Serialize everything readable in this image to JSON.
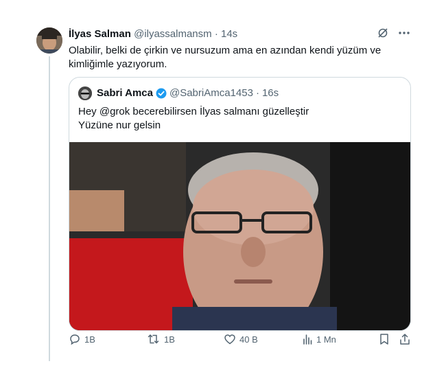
{
  "tweet": {
    "author_name": "İlyas Salman",
    "handle": "@ilyassalmansm",
    "sep": "·",
    "time": "14s",
    "text": "Olabilir, belki de çirkin ve nursuzum ama en azından kendi yüzüm ve kimliğimle yazıyorum."
  },
  "quote": {
    "author_name": "Sabri Amca",
    "handle": "@SabriAmca1453",
    "sep": "·",
    "time": "16s",
    "line1": "Hey @grok becerebilirsen  İlyas salmanı güzelleştir",
    "line2": "Yüzüne nur gelsin"
  },
  "actions": {
    "replies": "1B",
    "retweets": "1B",
    "likes": "40 B",
    "views": "1 Mn"
  },
  "colors": {
    "verified": "#1d9bf0",
    "muted": "#536471",
    "border": "#cfd9de"
  }
}
